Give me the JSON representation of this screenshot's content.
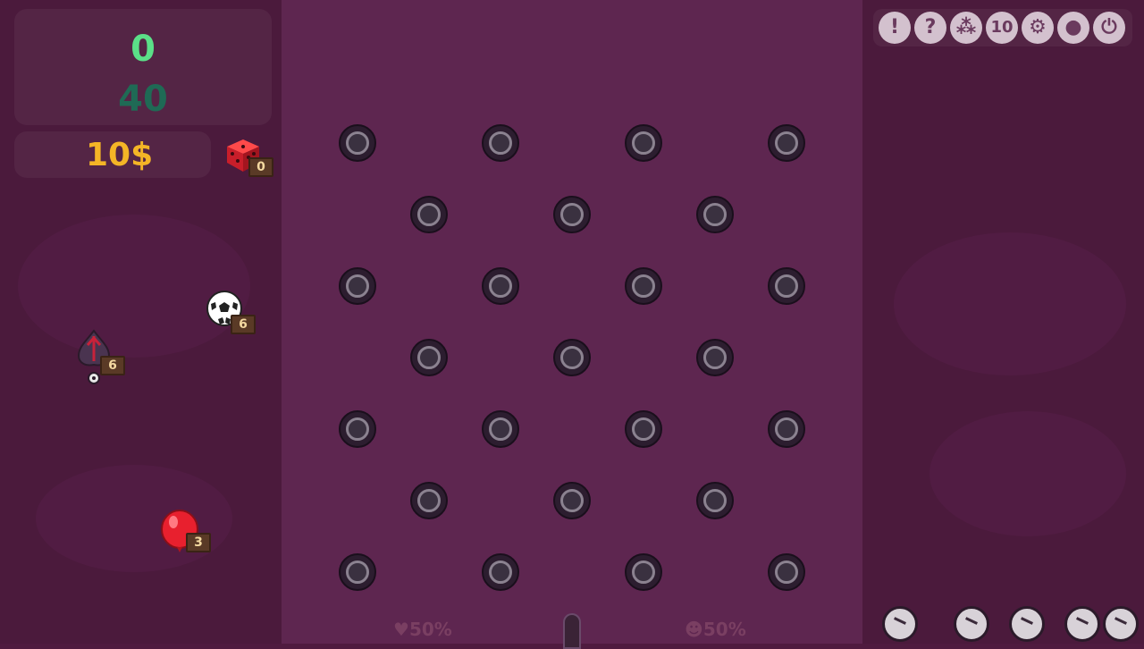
{
  "hud": {
    "score": "0",
    "target": "40",
    "money": "10$"
  },
  "items": [
    {
      "name": "dice",
      "count": "0"
    },
    {
      "name": "soccer-ball",
      "count": "6"
    },
    {
      "name": "spade-bomb",
      "count": "6"
    },
    {
      "name": "red-balloon",
      "count": "3"
    }
  ],
  "top_buttons": [
    {
      "name": "alert",
      "label": "!"
    },
    {
      "name": "help",
      "label": "?"
    },
    {
      "name": "balls",
      "label": "⁂"
    },
    {
      "name": "speed",
      "label": "10"
    },
    {
      "name": "settings",
      "label": "⚙"
    },
    {
      "name": "profile",
      "label": "●"
    },
    {
      "name": "power",
      "label": "⏻"
    }
  ],
  "bottom": {
    "left_odds": "50%",
    "right_odds": "50%"
  },
  "colors": {
    "score": "#5be088",
    "target": "#1f6a55",
    "money": "#f4b526",
    "background": "#4f1b3f"
  }
}
